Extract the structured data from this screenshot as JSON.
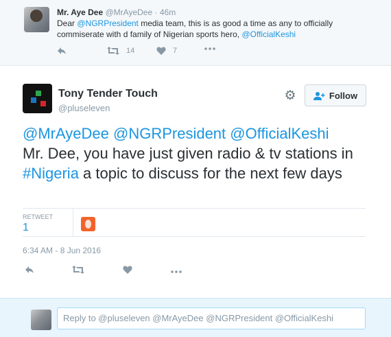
{
  "parent_tweet": {
    "name": "Mr. Aye Dee",
    "handle": "@MrAyeDee",
    "separator": "·",
    "time": "46m",
    "text_parts": {
      "t1": "Dear ",
      "m1": "@NGRPresident",
      "t2": " media team, this is as good a time as any to officially commiserate with d family of Nigerian sports hero, ",
      "m2": "@OfficialKeshi"
    },
    "retweet_count": "14",
    "like_count": "7"
  },
  "main_tweet": {
    "name": "Tony Tender Touch",
    "handle": "@pluseleven",
    "follow_label": "Follow",
    "text_parts": {
      "m1": "@MrAyeDee",
      "m2": "@NGRPresident",
      "m3": "@OfficialKeshi",
      "t1": "Mr. Dee, you have just given radio & tv stations in ",
      "h1": "#Nigeria",
      "t2": " a topic to discuss for the next few days"
    },
    "retweet_label": "RETWEET",
    "retweet_count": "1",
    "timestamp": "6:34 AM - 8 Jun 2016"
  },
  "reply": {
    "placeholder": "Reply to @pluseleven @MrAyeDee @NGRPresident @OfficialKeshi"
  },
  "icons": {
    "reply": "reply-icon",
    "retweet": "retweet-icon",
    "like": "heart-icon",
    "more": "more-icon",
    "gear": "gear-icon",
    "follow": "add-user-icon"
  },
  "colors": {
    "link": "#1b95e0",
    "muted": "#8899a6",
    "text": "#292f33"
  }
}
